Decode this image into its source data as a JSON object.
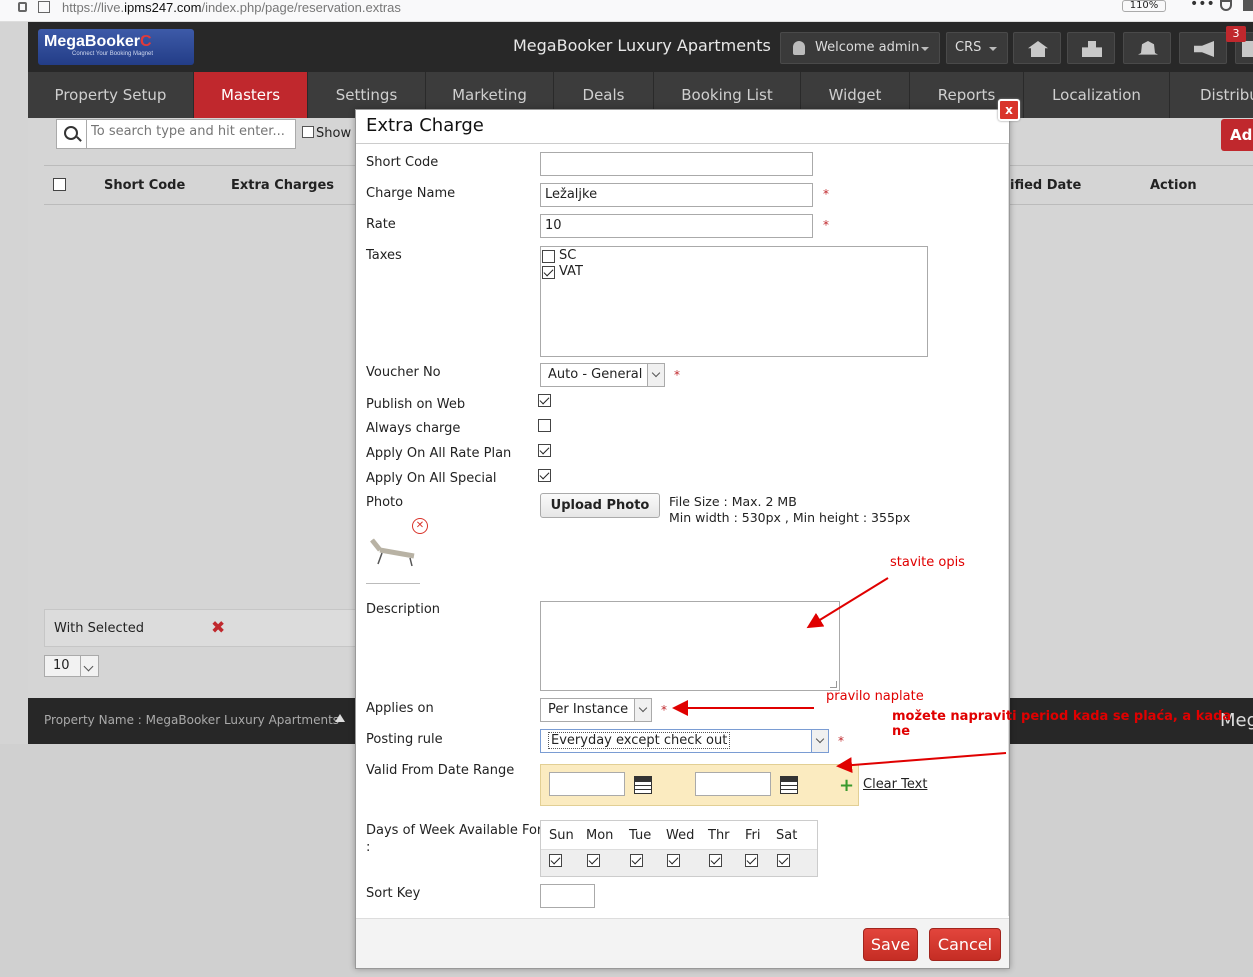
{
  "browser": {
    "url_prefix": "https://live.",
    "url_host": "ipms247.com",
    "url_path": "/index.php/page/reservation.extras",
    "zoom": "110%",
    "menu": "•••"
  },
  "header": {
    "logo_main": "MegaBooker",
    "logo_tag": "Connect Your Booking Magnet",
    "hotel_name": "MegaBooker Luxury Apartments",
    "welcome": "Welcome admin",
    "crs": "CRS",
    "notification_count": "3"
  },
  "nav": {
    "tabs": [
      "Property Setup",
      "Masters",
      "Settings",
      "Marketing",
      "Deals",
      "Booking List",
      "Widget",
      "Reports",
      "Localization",
      "Distribu"
    ]
  },
  "list": {
    "search_placeholder": "To search type and hit enter...",
    "show_label": "Show",
    "add_label": "Ad",
    "columns": [
      "Short Code",
      "Extra Charges",
      "ified Date",
      "Action"
    ],
    "with_selected": "With Selected",
    "per_page": "10"
  },
  "footer": {
    "property_name": "Property Name : MegaBooker Luxury Apartments",
    "brand": "Meg"
  },
  "modal": {
    "title": "Extra Charge",
    "close": "x",
    "fields": {
      "short_code_label": "Short Code",
      "short_code_value": "",
      "charge_name_label": "Charge Name",
      "charge_name_value": "Ležaljke",
      "rate_label": "Rate",
      "rate_value": "10",
      "taxes_label": "Taxes",
      "taxes": [
        {
          "name": "SC",
          "checked": false
        },
        {
          "name": "VAT",
          "checked": true
        }
      ],
      "voucher_label": "Voucher No",
      "voucher_value": "Auto - General",
      "publish_label": "Publish on Web",
      "always_label": "Always charge",
      "apply_rate_label": "Apply On All Rate Plan",
      "apply_special_label": "Apply On All Special",
      "photo_label": "Photo",
      "upload_label": "Upload Photo",
      "file_size": "File Size : Max. 2 MB",
      "min_size": "Min width : 530px , Min height : 355px",
      "description_label": "Description",
      "applies_label": "Applies on",
      "applies_value": "Per Instance",
      "posting_label": "Posting rule",
      "posting_value": "Everyday except check out",
      "valid_label": "Valid From Date Range",
      "clear_text": "Clear Text",
      "dow_label": "Days of Week Available For",
      "dow_label_2": ":",
      "days": [
        "Sun",
        "Mon",
        "Tue",
        "Wed",
        "Thr",
        "Fri",
        "Sat"
      ],
      "sort_label": "Sort Key",
      "required_mark": "*"
    },
    "save": "Save",
    "cancel": "Cancel"
  },
  "annotations": {
    "note1": "stavite opis",
    "note2": "pravilo naplate",
    "note3": "možete napraviti period kada se plaća, a kada ne"
  },
  "colors": {
    "accent_red": "#c0282d",
    "header_dark": "#282828",
    "annotation_red": "#e00000",
    "date_range_bg": "#fbebc0"
  }
}
